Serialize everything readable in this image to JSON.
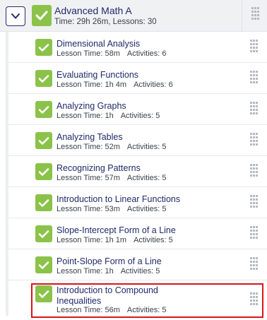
{
  "course": {
    "title": "Advanced Math A",
    "meta": "Time: 29h 26m, Lessons: 30",
    "completed": true
  },
  "lessons": [
    {
      "title": "Dimensional Analysis",
      "time": "Lesson Time: 58m",
      "activities": "Activities: 6",
      "completed": true
    },
    {
      "title": "Evaluating Functions",
      "time": "Lesson Time: 1h 4m",
      "activities": "Activities: 6",
      "completed": true
    },
    {
      "title": "Analyzing Graphs",
      "time": "Lesson Time: 1h",
      "activities": "Activities: 5",
      "completed": true
    },
    {
      "title": "Analyzing Tables",
      "time": "Lesson Time: 52m",
      "activities": "Activities: 5",
      "completed": true
    },
    {
      "title": "Recognizing Patterns",
      "time": "Lesson Time: 57m",
      "activities": "Activities: 5",
      "completed": true
    },
    {
      "title": "Introduction to Linear Functions",
      "time": "Lesson Time: 53m",
      "activities": "Activities: 5",
      "completed": true
    },
    {
      "title": "Slope-Intercept Form of a Line",
      "time": "Lesson Time: 1h 1m",
      "activities": "Activities: 5",
      "completed": true
    },
    {
      "title": "Point-Slope Form of a Line",
      "time": "Lesson Time: 1h",
      "activities": "Activities: 5",
      "completed": true
    },
    {
      "title_line1": "Introduction to Compound",
      "title_line2": "Inequalities",
      "time": "Lesson Time: 56m",
      "activities": "Activities: 5",
      "completed": true,
      "highlighted": true
    }
  ],
  "colors": {
    "accent_navy": "#1f2a6b",
    "check_green": "#8bc34a",
    "highlight_red": "#d9141b"
  },
  "icons": {
    "toggle": "chevron-down-icon",
    "status": "checkmark-icon",
    "reorder": "drag-handle-icon"
  }
}
